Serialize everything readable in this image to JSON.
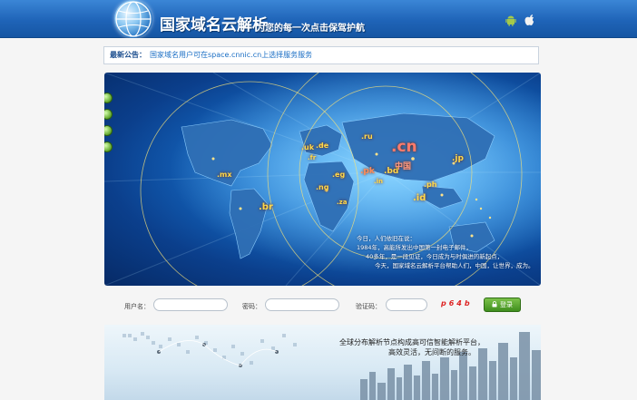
{
  "header": {
    "title": "国家域名云解析",
    "slogan": "为您的每一次点击保驾护航",
    "android_icon": "android-icon",
    "apple_icon": "apple-icon"
  },
  "notice": {
    "label": "最新公告：",
    "text": "国家域名用户可在space.cnnic.cn上选择服务服务"
  },
  "banner": {
    "domains": [
      ".cn",
      ".ru",
      ".uk",
      ".de",
      ".fr",
      ".eg",
      ".ng",
      ".za",
      ".mx",
      ".br",
      ".bd",
      ".pk",
      ".in",
      ".jp",
      ".ph",
      ".id",
      "中国"
    ],
    "caption_lines": [
      "今日，人们依旧在说：",
      "1984年，高能所发出中国第一封电子邮件，",
      "40多年，是一段见证，今日成为与时俱进的新起点，",
      "今天，国家域名云解析平台帮助人们，中国，让世界，成为。"
    ]
  },
  "login": {
    "username_label": "用户名：",
    "password_label": "密码：",
    "captcha_label": "验证码：",
    "captcha_value": "p64b",
    "submit_label": "登录"
  },
  "bottom": {
    "line1": "全球分布解析节点构成高可信智能解析平台，",
    "line2": "高效灵活，无间断的服务。"
  }
}
